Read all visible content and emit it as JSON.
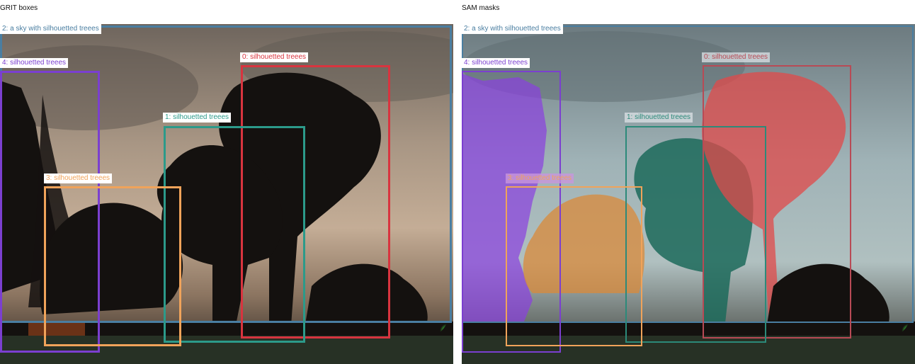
{
  "panels": {
    "left_title": "GRIT boxes",
    "right_title": "SAM masks"
  },
  "boxes": [
    {
      "label": "2: a sky with silhouetted treees",
      "color": "#4a7ea1"
    },
    {
      "label": "4: silhouetted treees",
      "color": "#7b3fd0"
    },
    {
      "label": "0: silhouetted treees",
      "color": "#d8343f"
    },
    {
      "label": "1: silhouetted treees",
      "color": "#2c9a8a"
    },
    {
      "label": "3: silhouetted treees",
      "color": "#f0a35a"
    }
  ],
  "mask_colors": {
    "sky": "#9fc2d0",
    "tree_0": "#e04a4a",
    "tree_1": "#1c6a5a",
    "tree_3": "#d98a3a",
    "tree_4": "#8a3fe0"
  }
}
